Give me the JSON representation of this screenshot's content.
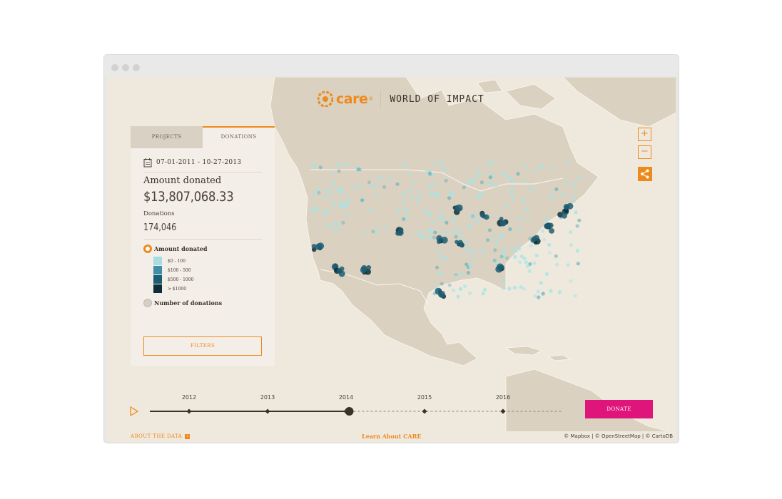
{
  "brand": {
    "logo_text": "care",
    "registered": "®",
    "title": "WORLD OF IMPACT",
    "accent_color": "#ee8a1c"
  },
  "panel": {
    "tabs": [
      {
        "label": "PROJECTS",
        "active": false
      },
      {
        "label": "DONATIONS",
        "active": true
      }
    ],
    "date_range": "07-01-2011 - 10-27-2013",
    "amount_label": "Amount donated",
    "amount_value": "$13,807,068.33",
    "donations_label": "Donations",
    "donations_value": "174,046",
    "metric_options": [
      {
        "label": "Amount donated",
        "selected": true
      },
      {
        "label": "Number of donations",
        "selected": false
      }
    ],
    "legend": [
      {
        "label": "$0 - 100",
        "color": "#a6dde3"
      },
      {
        "label": "$100 - 500",
        "color": "#3f8fa6"
      },
      {
        "label": "$500 - 1000",
        "color": "#1d5d72"
      },
      {
        "label": "> $1000",
        "color": "#0d2e38"
      }
    ],
    "filters_label": "FILTERS"
  },
  "map_controls": {
    "zoom_in": "+",
    "zoom_out": "−",
    "share_icon": "share-icon"
  },
  "timeline": {
    "years": [
      "2012",
      "2013",
      "2014",
      "2015",
      "2016"
    ],
    "play_icon": "play-icon",
    "progress_fraction": 0.5
  },
  "donate_label": "DONATE",
  "donate_color": "#e0157b",
  "footer": {
    "about": "ABOUT THE DATA",
    "learn": "Learn About CARE",
    "credits": "© Mapbox | © OpenStreetMap | © CartoDB"
  }
}
